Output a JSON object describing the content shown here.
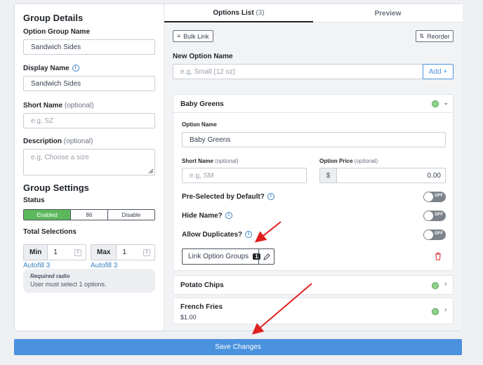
{
  "group_details": {
    "title": "Group Details",
    "option_group_name_label": "Option Group Name",
    "option_group_name_value": "Sandwich Sides",
    "display_name_label": "Display Name",
    "display_name_value": "Sandwich Sides",
    "short_name_label": "Short Name",
    "short_name_optional": "(optional)",
    "short_name_placeholder": "e.g, SZ",
    "description_label": "Description",
    "description_optional": "(optional)",
    "description_placeholder": "e.g, Choose a size"
  },
  "group_settings": {
    "title": "Group Settings",
    "status_label": "Status",
    "status_options": [
      "Enabled",
      "86",
      "Disable"
    ],
    "status_selected": "Enabled",
    "total_selections_label": "Total Selections",
    "min_label": "Min",
    "min_value": "1",
    "max_label": "Max",
    "max_value": "1",
    "autofill_min": "Autofill 3",
    "autofill_max": "Autofill 3",
    "note_title": "Required radio",
    "note_text": "User must select 1 options."
  },
  "tabs": {
    "options_list": "Options List",
    "options_count": "(3)",
    "preview": "Preview"
  },
  "toolbar": {
    "bulk_link": "Bulk Link",
    "reorder": "Reorder"
  },
  "new_option": {
    "label": "New Option Name",
    "placeholder": "e.g, Small (12 oz)",
    "add_label": "Add +"
  },
  "expanded_option": {
    "title": "Baby Greens",
    "option_name_label": "Option Name",
    "option_name_value": "Baby Greens",
    "short_name_label": "Short Name",
    "short_name_optional": "(optional)",
    "short_name_placeholder": "e.g, SM",
    "price_label": "Option Price",
    "price_optional": "(optional)",
    "currency": "$",
    "price_value": "0.00",
    "preselected_label": "Pre-Selected by Default?",
    "hide_name_label": "Hide Name?",
    "allow_duplicates_label": "Allow Duplicates?",
    "toggle_text": "OFF",
    "link_groups_label": "Link Option Groups",
    "link_groups_count": "1"
  },
  "collapsed_options": [
    {
      "title": "Potato Chips",
      "price": ""
    },
    {
      "title": "French Fries",
      "price": "$1.00"
    }
  ],
  "save_label": "Save Changes",
  "colors": {
    "primary": "#4b92de",
    "enabled": "#5cb85c",
    "arrow": "#e02020",
    "delete": "#e04848"
  }
}
